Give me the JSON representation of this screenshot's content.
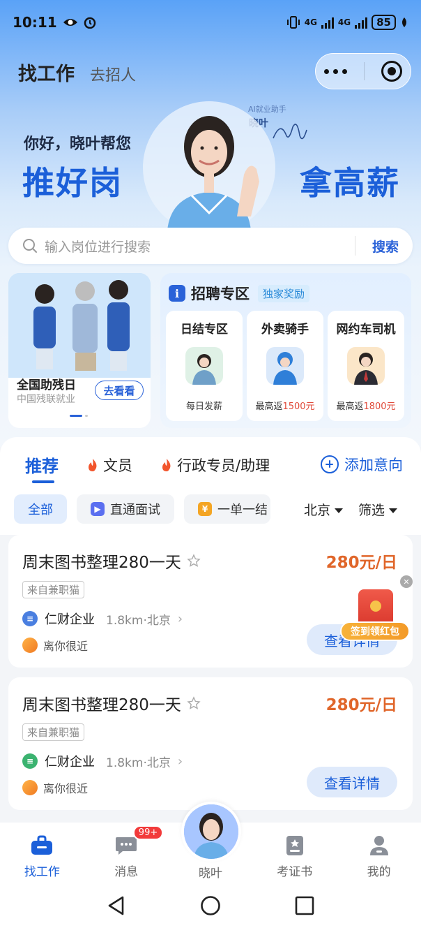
{
  "status": {
    "time": "10:11",
    "network": "4G",
    "battery": "85"
  },
  "nav": {
    "primary": "找工作",
    "secondary": "去招人"
  },
  "banner": {
    "greeting": "你好，晓叶帮您",
    "slogan_left": "推好岗",
    "slogan_right": "拿高薪",
    "ai_tag": "AI就业助手",
    "assistant_name": "晓叶"
  },
  "search": {
    "placeholder": "输入岗位进行搜索",
    "button": "搜索"
  },
  "promo": {
    "title": "全国助残日",
    "subtitle": "中国残联就业",
    "button": "去看看"
  },
  "zone": {
    "title": "招聘专区",
    "badge": "独家奖励",
    "cards": [
      {
        "title": "日结专区",
        "note_prefix": "每日发薪",
        "note_highlight": ""
      },
      {
        "title": "外卖骑手",
        "note_prefix": "最高返",
        "note_highlight": "1500元"
      },
      {
        "title": "网约车司机",
        "note_prefix": "最高返",
        "note_highlight": "1800元"
      }
    ]
  },
  "tabs": [
    {
      "label": "推荐"
    },
    {
      "label": "文员"
    },
    {
      "label": "行政专员/助理"
    }
  ],
  "add_intent": "添加意向",
  "filters": {
    "chips": [
      {
        "label": "全部"
      },
      {
        "label": "直通面试"
      },
      {
        "label": "一单一结"
      }
    ],
    "city": "北京",
    "screen": "筛选"
  },
  "jobs": [
    {
      "title": "周末图书整理280一天",
      "salary": "280元/日",
      "source": "来自兼职猫",
      "company": "仁财企业",
      "distance": "1.8km·北京",
      "near": "离你很近",
      "button": "查看详情"
    },
    {
      "title": "周末图书整理280一天",
      "salary": "280元/日",
      "source": "来自兼职猫",
      "company": "仁财企业",
      "distance": "1.8km·北京",
      "near": "离你很近",
      "button": "查看详情"
    }
  ],
  "redpack": {
    "label": "签到领红包"
  },
  "tabbar": [
    {
      "label": "找工作"
    },
    {
      "label": "消息",
      "badge": "99+"
    },
    {
      "label": "晓叶"
    },
    {
      "label": "考证书"
    },
    {
      "label": "我的"
    }
  ],
  "colors": {
    "primary": "#1b5fd9",
    "salary": "#e0662a",
    "highlight": "#e04a3a"
  }
}
